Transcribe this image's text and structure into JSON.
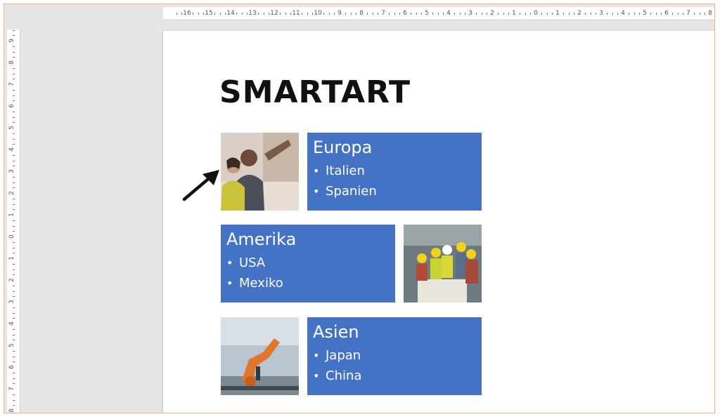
{
  "ruler_horizontal": [
    "16",
    "15",
    "14",
    "13",
    "12",
    "11",
    "10",
    "9",
    "8",
    "7",
    "6",
    "5",
    "4",
    "3",
    "2",
    "1",
    "0",
    "1",
    "2",
    "3",
    "4",
    "5",
    "6",
    "7",
    "8"
  ],
  "ruler_vertical": [
    "9",
    "8",
    "7",
    "6",
    "5",
    "4",
    "3",
    "2",
    "1",
    "0",
    "1",
    "2",
    "3",
    "4",
    "5",
    "6",
    "7",
    "8"
  ],
  "slide": {
    "title": "SMARTART",
    "groups": [
      {
        "heading": "Europa",
        "items": [
          "Italien",
          "Spanien"
        ]
      },
      {
        "heading": "Amerika",
        "items": [
          "USA",
          "Mexiko"
        ]
      },
      {
        "heading": "Asien",
        "items": [
          "Japan",
          "China"
        ]
      }
    ]
  },
  "colors": {
    "box_fill": "#4472c4",
    "frame_border": "#f0b27a",
    "workspace": "#e6e6e6"
  },
  "icons": {
    "arrow": "arrow-pointer-icon",
    "bullet": "•"
  }
}
